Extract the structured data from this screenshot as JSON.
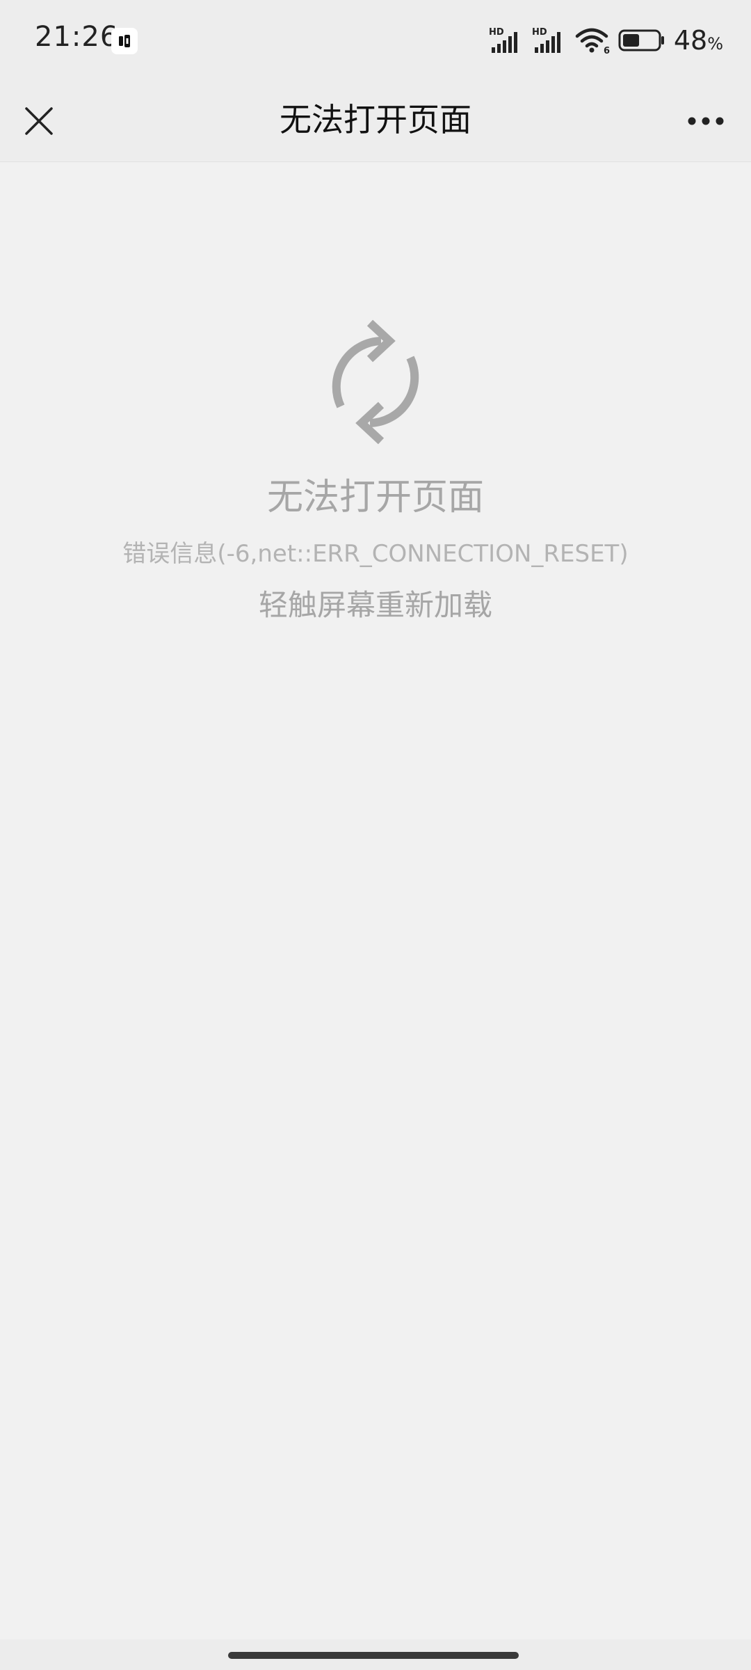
{
  "status_bar": {
    "time": "21:26",
    "app_icon": "app-notification-icon",
    "sim1_label": "HD",
    "sim2_label": "HD",
    "wifi_label": "6",
    "battery_percent": "48",
    "battery_percent_sign": "%",
    "battery_level": 0.48
  },
  "title_bar": {
    "title": "无法打开页面",
    "close_icon": "close-icon",
    "more_icon": "more-icon"
  },
  "error": {
    "icon": "reload-icon",
    "title": "无法打开页面",
    "info": "错误信息(-6,net::ERR_CONNECTION_RESET)",
    "hint": "轻触屏幕重新加载"
  },
  "colors": {
    "background": "#f1f1f1",
    "bar_background": "#ededed",
    "muted_text": "#a6a6a6",
    "icon_gray": "#a8a8a8"
  }
}
